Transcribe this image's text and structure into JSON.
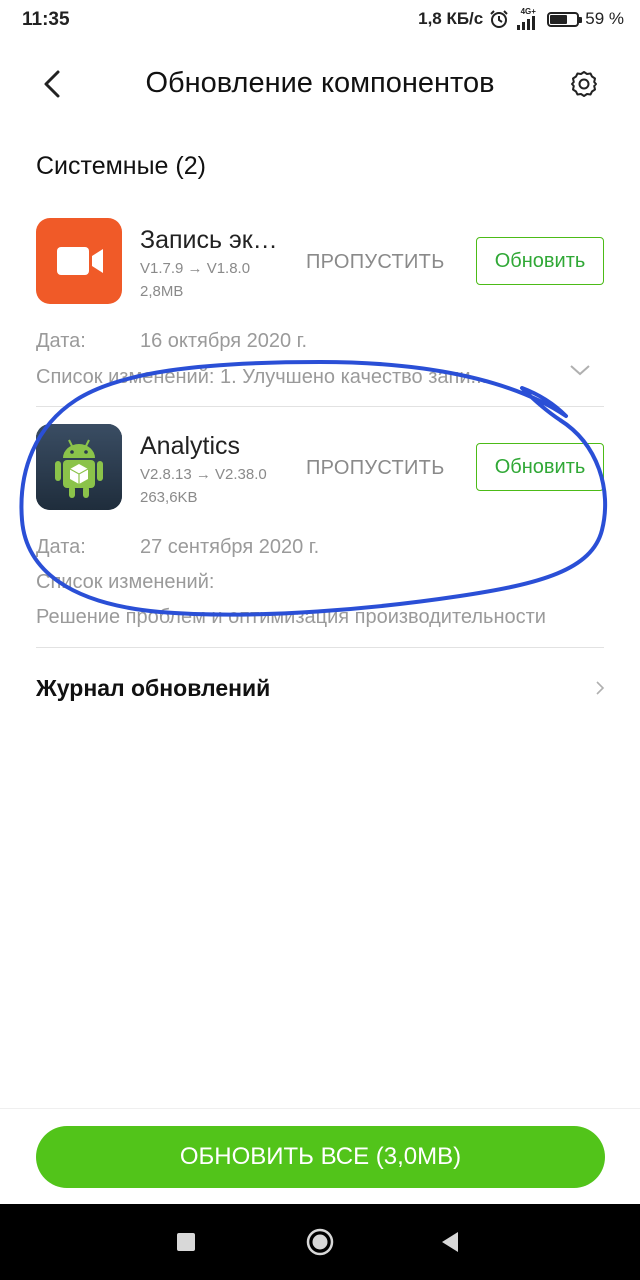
{
  "status_bar": {
    "time": "11:35",
    "speed": "1,8 КБ/с",
    "network_label_top": "4G+",
    "battery": "59 %",
    "battery_level": 0.59
  },
  "header": {
    "title": "Обновление компонентов",
    "back_icon": "chevron-left-icon",
    "settings_icon": "gear-icon"
  },
  "section": {
    "title": "Системные (2)"
  },
  "apps": [
    {
      "name": "Запись эк…",
      "version": "V1.7.9 → V1.8.0",
      "size": "2,8MB",
      "skip_label": "ПРОПУСТИТЬ",
      "update_label": "Обновить",
      "date_label": "Дата:",
      "date_value": "16 октября 2020 г.",
      "changes_text": "Список изменений: 1. Улучшено качество запи...",
      "icon": "video-camera-icon",
      "icon_color": "#f05a28"
    },
    {
      "name": "Analytics",
      "version": "V2.8.13 → V2.38.0",
      "size": "263,6KB",
      "skip_label": "ПРОПУСТИТЬ",
      "update_label": "Обновить",
      "date_label": "Дата:",
      "date_value": "27 сентября 2020 г.",
      "changes_label": "Список изменений:",
      "changes_text": "Решение проблем и оптимизация производительности",
      "icon": "android-robot-icon",
      "icon_color": "#2b3b4d"
    }
  ],
  "history": {
    "label": "Журнал обновлений"
  },
  "update_all": {
    "label": "ОБНОВИТЬ ВСЕ (3,0MB)",
    "color": "#52c41a"
  },
  "colors": {
    "accent_green": "#4cbb17",
    "annotation_blue": "#2a4fd6"
  }
}
